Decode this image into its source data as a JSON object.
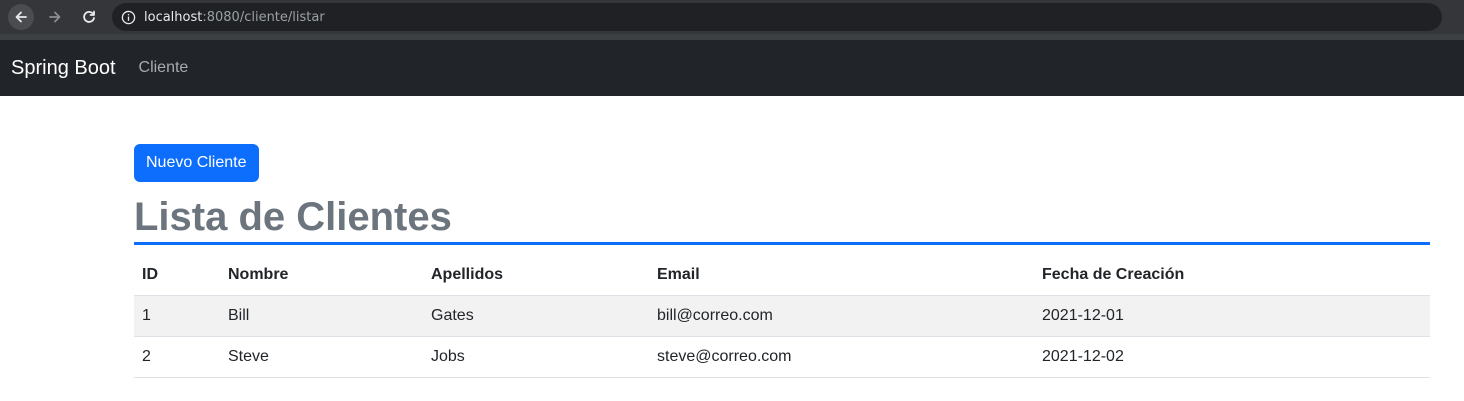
{
  "browser": {
    "url_host": "localhost",
    "url_path": ":8080/cliente/listar",
    "icons": [
      "back-arrow-icon",
      "forward-arrow-icon",
      "reload-icon",
      "info-icon"
    ]
  },
  "navbar": {
    "brand": "Spring Boot",
    "links": [
      {
        "label": "Cliente"
      }
    ]
  },
  "main": {
    "new_button_label": "Nuevo Cliente",
    "title": "Lista de Clientes",
    "table": {
      "headers": [
        "ID",
        "Nombre",
        "Apellidos",
        "Email",
        "Fecha de Creación"
      ],
      "rows": [
        [
          "1",
          "Bill",
          "Gates",
          "bill@correo.com",
          "2021-12-01"
        ],
        [
          "2",
          "Steve",
          "Jobs",
          "steve@correo.com",
          "2021-12-02"
        ]
      ]
    }
  },
  "colors": {
    "navbar_bg": "#212529",
    "primary": "#0d6efd",
    "title_color": "#6c757d",
    "striped_row": "#f2f2f2"
  }
}
